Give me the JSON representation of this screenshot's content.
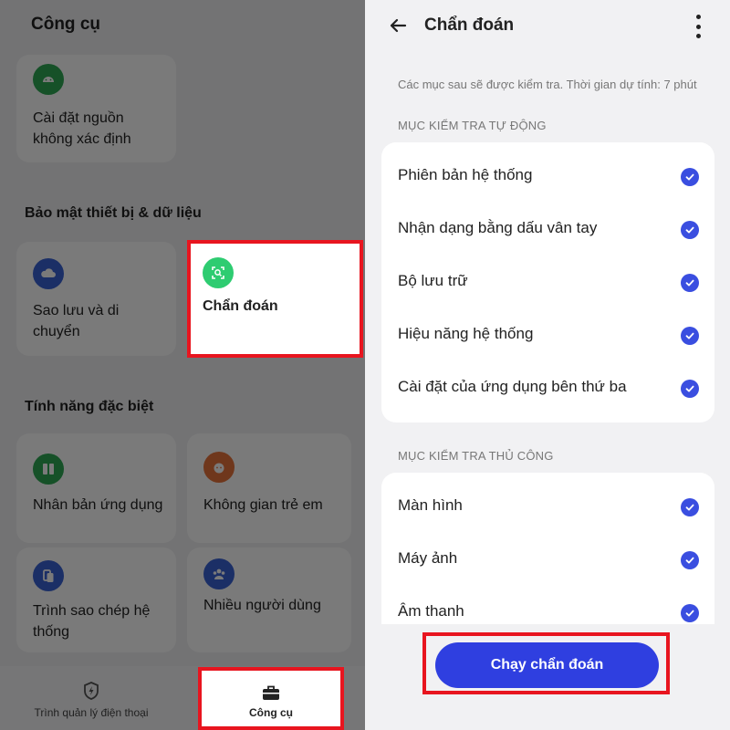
{
  "left": {
    "title": "Công cụ",
    "install_unknown": "Cài đặt nguồn\nkhông xác định",
    "section_security": "Bảo mật thiết bị & dữ liệu",
    "backup": "Sao lưu và di\nchuyển",
    "diagnosis": "Chẩn đoán",
    "section_special": "Tính năng đặc biệt",
    "clone_app": "Nhân bản ứng dụng",
    "kids_space": "Không gian trẻ em",
    "phone_clone": "Trình sao chép hệ\nthống",
    "multi_user": "Nhiều người dùng",
    "nav": {
      "phone_manager": "Trình quản lý điện thoại",
      "tools": "Công cụ"
    }
  },
  "right": {
    "title": "Chẩn đoán",
    "description": "Các mục sau sẽ được kiểm tra. Thời gian dự tính: 7 phút",
    "auto_header": "MỤC KIỂM TRA TỰ ĐỘNG",
    "auto_items": [
      "Phiên bản hệ thống",
      "Nhận dạng bằng dấu vân tay",
      "Bộ lưu trữ",
      "Hiệu năng hệ thống",
      "Cài đặt của ứng dụng bên thứ ba"
    ],
    "manual_header": "MỤC KIỂM TRA THỦ CÔNG",
    "manual_items": [
      "Màn hình",
      "Máy ảnh",
      "Âm thanh"
    ],
    "run_button": "Chạy chẩn đoán"
  },
  "colors": {
    "accent": "#2f3fe0",
    "check": "#3a4ee0",
    "highlight": "#e8151f",
    "green": "#2ecc71",
    "blue": "#3a62d6",
    "orange": "#e8743b"
  }
}
